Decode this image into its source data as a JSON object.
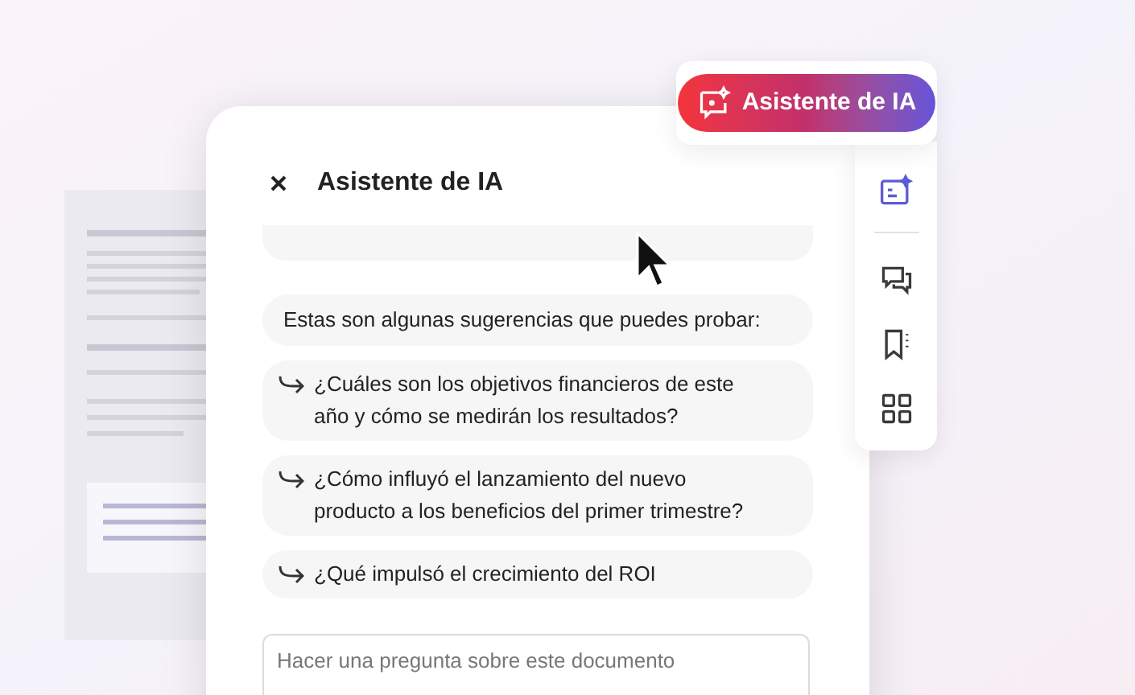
{
  "assistant_button": {
    "label": "Asistente de IA"
  },
  "panel": {
    "title": "Asistente de IA",
    "intro": "Estas son algunas sugerencias que puedes probar:",
    "suggestions": [
      {
        "text": "¿Cuáles son los objetivos financieros de este año y cómo se medirán los resultados?"
      },
      {
        "text": "¿Cómo influyó el lanzamiento del nuevo producto a los beneficios del primer trimestre?"
      },
      {
        "text": "¿Qué impulsó el crecimiento del ROI"
      }
    ],
    "input": {
      "placeholder": "Hacer una pregunta sobre este documento"
    }
  },
  "toolbar": [
    {
      "kind": "ai",
      "selected": true
    },
    {
      "kind": "comments",
      "selected": false
    },
    {
      "kind": "bookmarks",
      "selected": false
    },
    {
      "kind": "grid",
      "selected": false
    }
  ]
}
